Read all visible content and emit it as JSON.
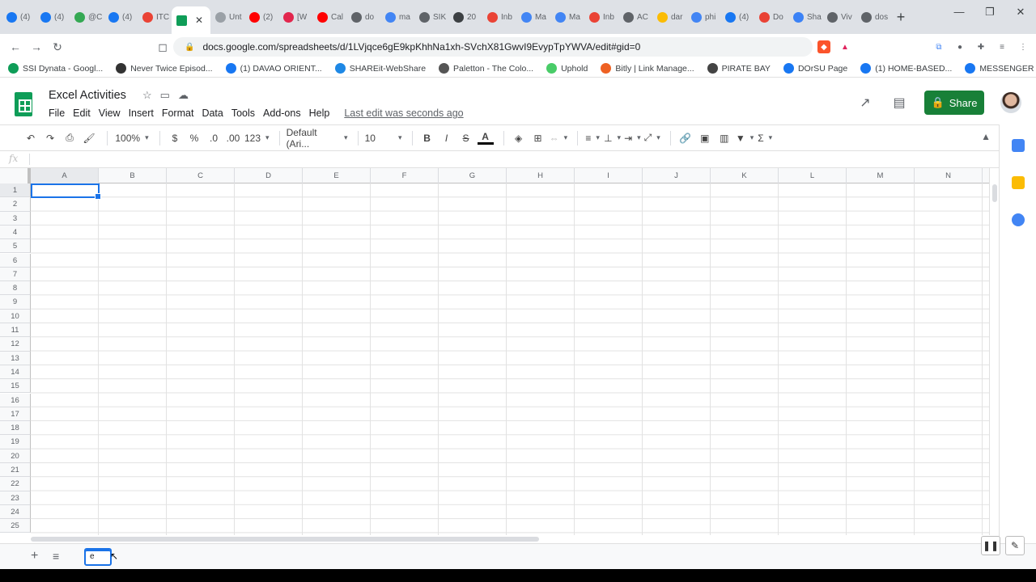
{
  "browser": {
    "tabs": [
      {
        "title": "(4)",
        "color": "#1877f2"
      },
      {
        "title": "(4)",
        "color": "#1877f2"
      },
      {
        "title": "@C",
        "color": "#34a853"
      },
      {
        "title": "(4)",
        "color": "#1877f2"
      },
      {
        "title": "ITC",
        "color": "#ea4335"
      },
      {
        "title": "Unt",
        "color": "#9aa0a6"
      },
      {
        "title": "(2)",
        "color": "#ff0000"
      },
      {
        "title": "[W",
        "color": "#e2264d"
      },
      {
        "title": "Cal",
        "color": "#ff0000"
      },
      {
        "title": "do",
        "color": "#5f6368"
      },
      {
        "title": "ma",
        "color": "#4285f4"
      },
      {
        "title": "SIK",
        "color": "#5f6368"
      },
      {
        "title": "20",
        "color": "#3c4043"
      },
      {
        "title": "Inb",
        "color": "#ea4335"
      },
      {
        "title": "Ma",
        "color": "#4285f4"
      },
      {
        "title": "Ma",
        "color": "#4285f4"
      },
      {
        "title": "Inb",
        "color": "#ea4335"
      },
      {
        "title": "AC",
        "color": "#5f6368"
      },
      {
        "title": "dar",
        "color": "#fbbc04"
      },
      {
        "title": "phi",
        "color": "#4285f4"
      },
      {
        "title": "(4)",
        "color": "#1877f2"
      },
      {
        "title": "Do",
        "color": "#e94235"
      },
      {
        "title": "Sha",
        "color": "#3b82f6"
      },
      {
        "title": "Viv",
        "color": "#5f6368"
      },
      {
        "title": "dos",
        "color": "#5f6368"
      }
    ],
    "url": "docs.google.com/spreadsheets/d/1LVjqce6gE9kpKhhNa1xh-SVchX81GwvI9EvypTpYWVA/edit#gid=0",
    "bookmarks": [
      {
        "label": "SSI Dynata - Googl...",
        "color": "#0f9d58"
      },
      {
        "label": "Never Twice Episod...",
        "color": "#333333"
      },
      {
        "label": "(1) DAVAO ORIENT...",
        "color": "#1877f2"
      },
      {
        "label": "SHAREit-WebShare",
        "color": "#1e88e5"
      },
      {
        "label": "Paletton - The Colo...",
        "color": "#555555"
      },
      {
        "label": "Uphold",
        "color": "#49cc68"
      },
      {
        "label": "Bitly | Link Manage...",
        "color": "#ee6123"
      },
      {
        "label": "PIRATE BAY",
        "color": "#444444"
      },
      {
        "label": "DOrSU Page",
        "color": "#1877f2"
      },
      {
        "label": "(1) HOME-BASED...",
        "color": "#1877f2"
      },
      {
        "label": "MESSENGER",
        "color": "#1877f2"
      }
    ]
  },
  "app": {
    "title": "Excel Activities",
    "menu": [
      "File",
      "Edit",
      "View",
      "Insert",
      "Format",
      "Data",
      "Tools",
      "Add-ons",
      "Help"
    ],
    "last_edit": "Last edit was seconds ago",
    "share_label": "Share"
  },
  "toolbar": {
    "zoom": "100%",
    "currency": "$",
    "percent": "%",
    "dec_decrease": ".0",
    "dec_increase": ".00",
    "more_formats": "123",
    "font": "Default (Ari...",
    "font_size": "10",
    "bold": "B",
    "italic": "I",
    "strike": "S",
    "text_color": "A",
    "sum": "Σ"
  },
  "formula": {
    "fx": "fx"
  },
  "grid": {
    "columns": [
      "A",
      "B",
      "C",
      "D",
      "E",
      "F",
      "G",
      "H",
      "I",
      "J",
      "K",
      "L",
      "M",
      "N"
    ],
    "rows": [
      "1",
      "2",
      "3",
      "4",
      "5",
      "6",
      "7",
      "8",
      "9",
      "10",
      "11",
      "12",
      "13",
      "14",
      "15",
      "16",
      "17",
      "18",
      "19",
      "20",
      "21",
      "22",
      "23",
      "24",
      "25"
    ],
    "active_cell": "A1"
  },
  "sheets": {
    "tab_editing_text": "e"
  },
  "colors": {
    "sheets_green": "#0f9d58",
    "share_green": "#188038",
    "selection_blue": "#1a73e8"
  }
}
